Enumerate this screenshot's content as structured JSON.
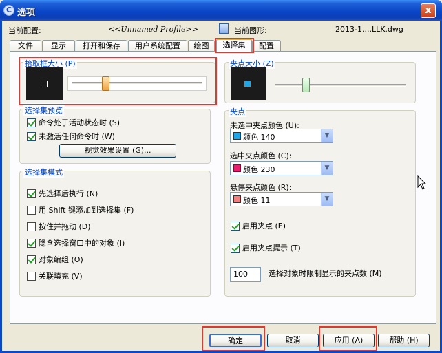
{
  "window": {
    "title": "选项",
    "icon": "app-icon",
    "close_label": "x"
  },
  "profile": {
    "label": "当前配置:",
    "value": "<<Unnamed Profile>>",
    "drawing_label": "当前图形:",
    "drawing_value": "2013-1....LLK.dwg",
    "drawing_icon": "drawing-icon"
  },
  "tabs": [
    {
      "label": "文件"
    },
    {
      "label": "显示"
    },
    {
      "label": "打开和保存"
    },
    {
      "label": "用户系统配置"
    },
    {
      "label": "绘图"
    },
    {
      "label": "选择集"
    },
    {
      "label": "配置"
    }
  ],
  "active_tab": "选择集",
  "pickbox": {
    "title": "拾取框大小 (P)"
  },
  "grip_size": {
    "title": "夹点大小 (Z)"
  },
  "preview": {
    "title": "选择集预览",
    "items": [
      {
        "label": "命令处于活动状态时 (S)",
        "checked": true
      },
      {
        "label": "未激活任何命令时 (W)",
        "checked": true
      }
    ],
    "button_label": "视觉效果设置 (G)..."
  },
  "mode": {
    "title": "选择集模式",
    "items": [
      {
        "label": "先选择后执行 (N)",
        "checked": true
      },
      {
        "label": "用 Shift 键添加到选择集 (F)",
        "checked": false
      },
      {
        "label": "按住并拖动 (D)",
        "checked": false
      },
      {
        "label": "隐含选择窗口中的对象 (I)",
        "checked": true
      },
      {
        "label": "对象编组 (O)",
        "checked": true
      },
      {
        "label": "关联填充 (V)",
        "checked": false
      }
    ]
  },
  "grips": {
    "title": "夹点",
    "unselected": {
      "label": "未选中夹点颜色 (U):",
      "value": "颜色 140",
      "color": "#1ea7e8"
    },
    "selected": {
      "label": "选中夹点颜色 (C):",
      "value": "颜色 230",
      "color": "#e8206e"
    },
    "hover": {
      "label": "悬停夹点颜色 (R):",
      "value": "颜色 11",
      "color": "#f08080"
    },
    "enable": {
      "label": "启用夹点 (E)",
      "checked": true
    },
    "tips": {
      "label": "启用夹点提示 (T)",
      "checked": true
    },
    "limit_value": "100",
    "limit_label": "选择对象时限制显示的夹点数 (M)"
  },
  "buttons": {
    "ok": "确定",
    "cancel": "取消",
    "apply": "应用 (A)",
    "help": "帮助 (H)"
  },
  "colors": {
    "accent": "#0046d5",
    "highlight": "#e03a30",
    "titlebar": "#0a46c8"
  }
}
